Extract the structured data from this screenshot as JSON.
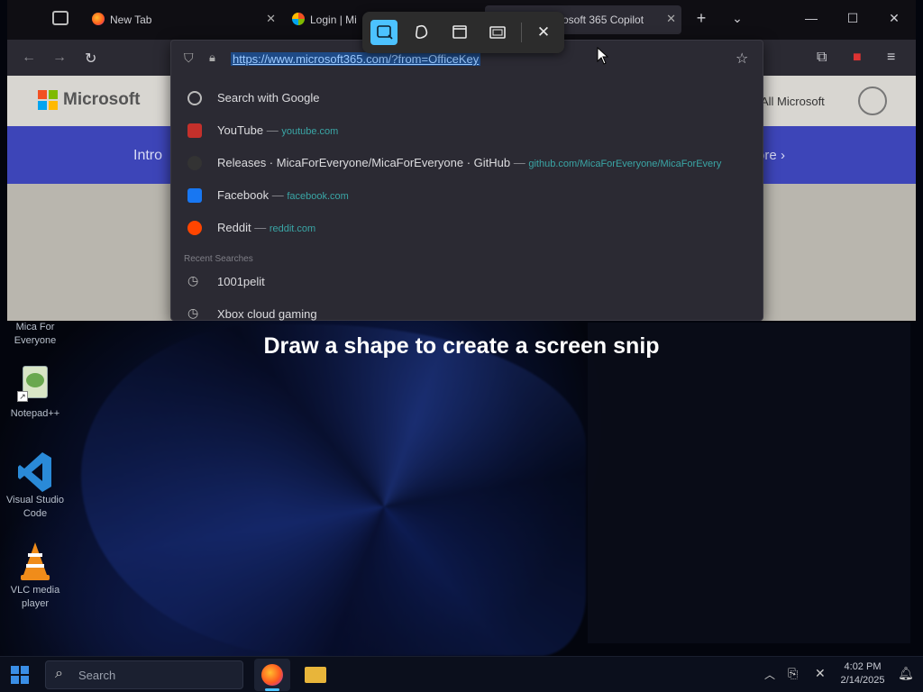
{
  "browser": {
    "tabs": [
      {
        "label": "New Tab"
      },
      {
        "label": "Login | Mi"
      },
      {
        "label": "rosoft 365 Copilot"
      }
    ],
    "url": "https://www.microsoft365.com/?from=OfficeKey",
    "new_tab_symbol": "+",
    "page": {
      "logo_text": "Microsoft",
      "all_microsoft": "All Microsoft",
      "banner_left": "Intro",
      "banner_right": "ore"
    }
  },
  "url_dropdown": {
    "search_suggestion": "Search with Google",
    "suggestions": [
      {
        "title": "YouTube",
        "dash": "—",
        "url": "youtube.com",
        "color": "#c4302b"
      },
      {
        "title": "Releases · MicaForEveryone/MicaForEveryone · GitHub",
        "dash": "—",
        "url": "github.com/MicaForEveryone/MicaForEvery",
        "color": "#333333"
      },
      {
        "title": "Facebook",
        "dash": "—",
        "url": "facebook.com",
        "color": "#1877f2"
      },
      {
        "title": "Reddit",
        "dash": "—",
        "url": "reddit.com",
        "color": "#ff4500"
      }
    ],
    "recent_label": "Recent Searches",
    "recent": [
      "1001pelit",
      "Xbox cloud gaming"
    ]
  },
  "snip": {
    "message": "Draw a shape to create a screen snip",
    "modes": [
      "rectangle-mode",
      "freeform-mode",
      "window-mode",
      "fullscreen-mode"
    ],
    "accent": "#4cc2ff"
  },
  "desktop_icons": [
    {
      "label": "Mica For Everyone"
    },
    {
      "label": "Notepad++"
    },
    {
      "label": "Visual Studio Code"
    },
    {
      "label": "VLC media player"
    }
  ],
  "taskbar": {
    "search_placeholder": "Search",
    "time": "4:02 PM",
    "date": "2/14/2025"
  }
}
